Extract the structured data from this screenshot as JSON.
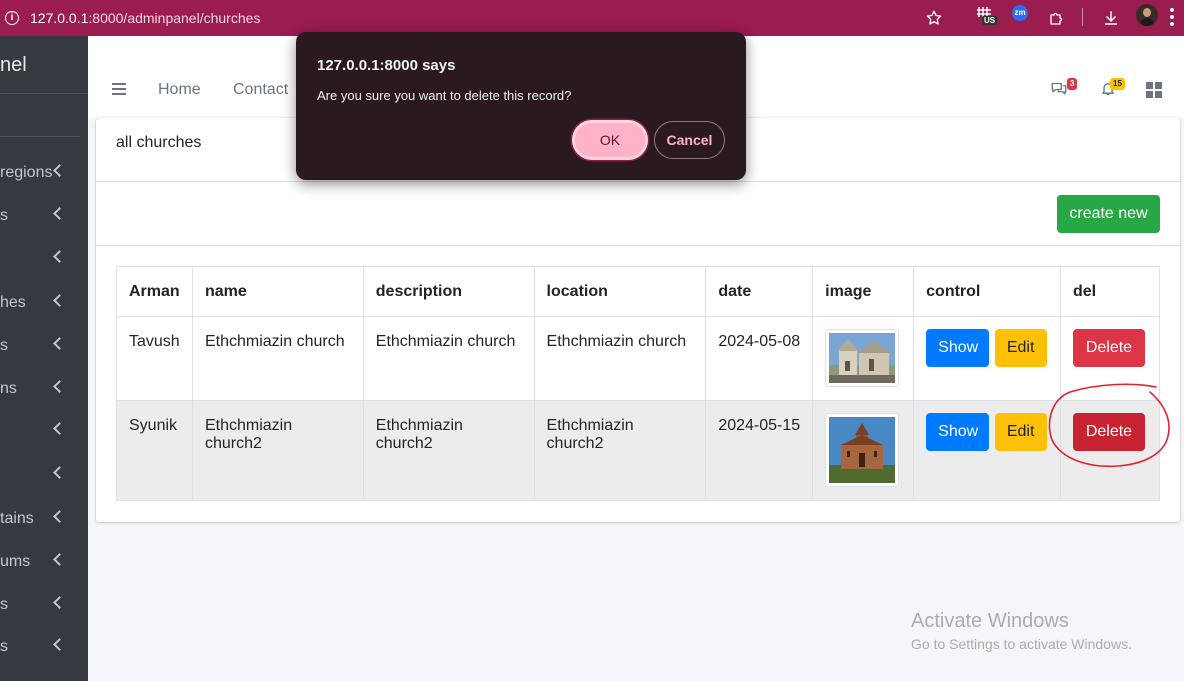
{
  "browser": {
    "url_host": "127.0.0.1",
    "url_rest": ":8000/adminpanel/churches",
    "extension_badge": "US",
    "zoom_ext_label": "zm"
  },
  "sidebar": {
    "brand": "nel",
    "items": [
      {
        "label": "regions"
      },
      {
        "label": "s"
      },
      {
        "label": ""
      },
      {
        "label": "hes"
      },
      {
        "label": "s"
      },
      {
        "label": "ns"
      },
      {
        "label": ""
      },
      {
        "label": ""
      },
      {
        "label": "tains"
      },
      {
        "label": "ums"
      },
      {
        "label": "s"
      },
      {
        "label": "s"
      }
    ]
  },
  "navbar": {
    "links": [
      "Home",
      "Contact"
    ],
    "messages_count": "3",
    "notifications_count": "15"
  },
  "card": {
    "title": "all churches",
    "create_label": "create new"
  },
  "table": {
    "headers": [
      "Arman",
      "name",
      "description",
      "location",
      "date",
      "image",
      "control",
      "del"
    ],
    "rows": [
      {
        "region": "Tavush",
        "name": "Ethchmiazin church",
        "description": "Ethchmiazin church",
        "location": "Ethchmiazin church",
        "date": "2024-05-08"
      },
      {
        "region": "Syunik",
        "name": "Ethchmiazin church2",
        "description": "Ethchmiazin church2",
        "location": "Ethchmiazin church2",
        "date": "2024-05-15"
      }
    ],
    "show_label": "Show",
    "edit_label": "Edit",
    "delete_label": "Delete"
  },
  "dialog": {
    "title": "127.0.0.1:8000 says",
    "message": "Are you sure you want to delete this record?",
    "ok_label": "OK",
    "cancel_label": "Cancel"
  },
  "watermark": {
    "title": "Activate Windows",
    "subtitle": "Go to Settings to activate Windows."
  },
  "colors": {
    "browser_bar": "#9b1c4f",
    "sidebar": "#343a40",
    "success": "#28a745",
    "primary": "#007bff",
    "warning": "#ffc107",
    "danger": "#dc3545",
    "annotation": "#e8202e"
  }
}
